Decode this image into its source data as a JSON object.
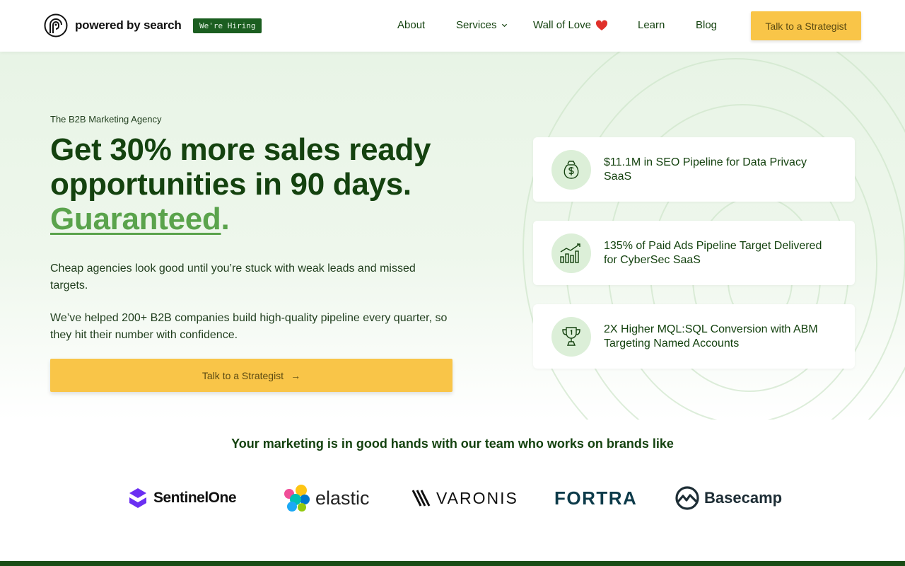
{
  "header": {
    "logo_text": "powered by search",
    "hiring_badge": "We're Hiring",
    "nav": [
      {
        "label": "About"
      },
      {
        "label": "Services"
      },
      {
        "label": "Wall of Love"
      },
      {
        "label": "Learn"
      },
      {
        "label": "Blog"
      }
    ],
    "cta_label": "Talk to a Strategist"
  },
  "hero": {
    "eyebrow": "The B2B Marketing Agency",
    "headline_line1": "Get 30% more sales ready",
    "headline_line2": "opportunities in 90 days.",
    "headline_green": "Guaranteed",
    "headline_period": ".",
    "paragraph1": "Cheap agencies look good until you’re stuck with weak leads and missed targets.",
    "paragraph2": "We’ve helped 200+ B2B companies build high-quality pipeline every quarter, so they hit their number with confidence.",
    "cta_label": "Talk to a Strategist"
  },
  "cards": [
    {
      "icon": "money-bag-icon",
      "text": "$11.1M in SEO Pipeline for Data Privacy SaaS"
    },
    {
      "icon": "growth-chart-icon",
      "text": "135% of Paid Ads Pipeline Target Delivered for CyberSec SaaS"
    },
    {
      "icon": "trophy-icon",
      "text": "2X Higher MQL:SQL Conversion with ABM Targeting Named Accounts"
    }
  ],
  "brands": {
    "title": "Your marketing is in good hands with our team who works on brands like",
    "logos": [
      "SentinelOne",
      "elastic",
      "VARONIS",
      "FORTRA",
      "Basecamp"
    ]
  },
  "colors": {
    "primary_green": "#14420f",
    "accent_green": "#5aa34c",
    "cta_yellow": "#f9c548",
    "hiring_bg": "#1b5e20"
  }
}
